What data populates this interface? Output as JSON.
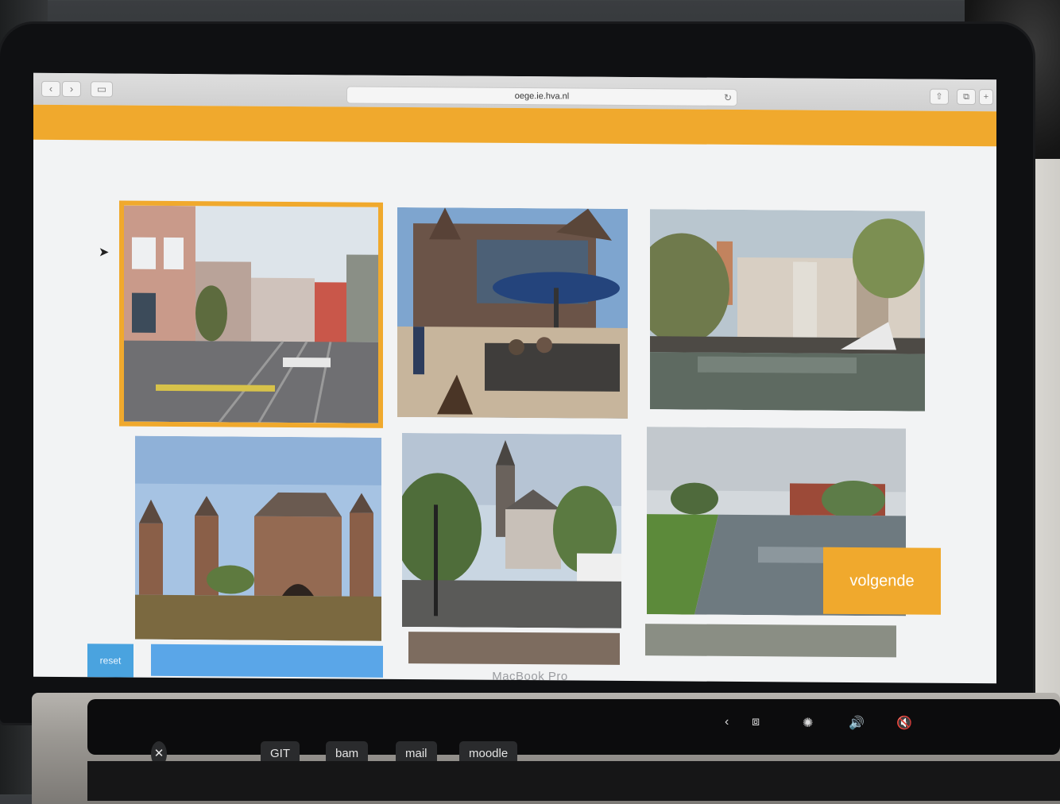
{
  "browser": {
    "address": "oege.ie.hva.nl",
    "back_icon": "chevron-left-icon",
    "forward_icon": "chevron-right-icon",
    "sidebar_icon": "sidebar-icon",
    "reload_icon": "reload-icon",
    "share_icon": "share-icon",
    "tabs_icon": "tabs-icon",
    "new_tab_icon": "plus-icon"
  },
  "page": {
    "accent": "#f0a92d",
    "next_label": "volgende",
    "reset_label": "reset",
    "photos": [
      {
        "subject": "street-with-tram-tracks",
        "selected": true
      },
      {
        "subject": "church-square-terrace",
        "selected": false
      },
      {
        "subject": "canal-with-tower",
        "selected": false
      },
      {
        "subject": "water-gate-castle",
        "selected": false
      },
      {
        "subject": "village-church",
        "selected": false
      },
      {
        "subject": "river-with-houses",
        "selected": false
      }
    ]
  },
  "laptop": {
    "brand": "MacBook Pro",
    "touchbar": {
      "esc": "esc",
      "items": [
        "GIT",
        "bam",
        "mail",
        "moodle"
      ]
    }
  }
}
